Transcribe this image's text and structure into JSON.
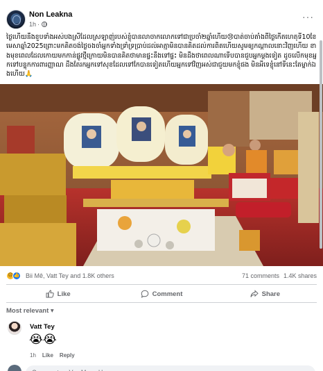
{
  "post": {
    "author": "Non Leakna",
    "time": "1h",
    "more_label": "···",
    "caption": "ថ្ងៃហើយនឹងខួបទាំងអស់បងស្រីដែលស្រឡាញ់របស់ខ្ញុំបានលាចាកលោកទៅជាប្រចាំ២ឆ្នាំហើយ😢បាត់ចាប់តាំងពីថ្ងៃកើតហេតុទី10ខែមេសាឆ្នាំ2025ព្រោះមកគិតចង់ថ្ងៃចងចាំអ្នកទាំងទ្រាំទ្រប្រាប់ដល់អាត្មាមិនបានគិតដល់ការពិតហើយសូមឲ្យកណ្ដាលនោះវិញហើយ ខាងមុខពេលដែលកោយមកកាន់ផ្លូវថ្មីក្រោយមិនបានគិតថាមានផ្ទះនឹងទៅផ្ទះ មិនដឹងថាពេលណាទើបបានជួបអ្នកម្ដងទៀត ដូចលើកមុខអ្នកទៅបន្ទុកការពារញ្ញាណ ដឹងតែរកអ្នកទៅសុខដែលទៅកែបានទៀតហើយអ្នកទៅវិញអស់ជាជួយមកខ្ញុំផង មិនអីទេខ្ញុំនៅទីនេះតែម្នាក់ឯងហើយ🙏"
  },
  "reactions": {
    "icons": [
      "sad-icon",
      "like-icon"
    ],
    "names": "Bii Mê, Vatt Tey and 1.8K others",
    "comments": "71 comments",
    "shares": "1.4K shares"
  },
  "actions": {
    "like": "Like",
    "comment": "Comment",
    "share": "Share"
  },
  "comments_filter": "Most relevant",
  "comment": {
    "author": "Vatt Tey",
    "text": "😭😭",
    "time": "1h",
    "like": "Like",
    "reply": "Reply"
  },
  "write_comment": {
    "placeholder": "Comment as Vay Mang Haang"
  },
  "colors": {
    "accent": "#1877f2",
    "muted_text": "#65676b",
    "divider": "#ced0d4"
  }
}
